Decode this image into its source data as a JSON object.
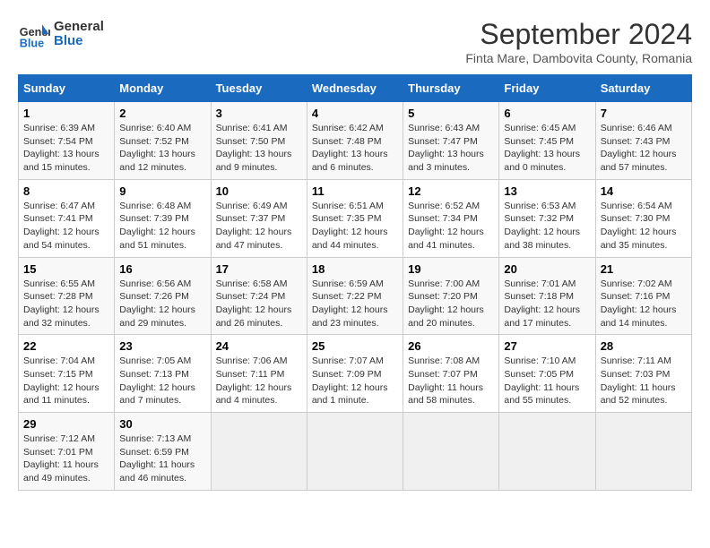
{
  "header": {
    "logo_line1": "General",
    "logo_line2": "Blue",
    "month_year": "September 2024",
    "location": "Finta Mare, Dambovita County, Romania"
  },
  "weekdays": [
    "Sunday",
    "Monday",
    "Tuesday",
    "Wednesday",
    "Thursday",
    "Friday",
    "Saturday"
  ],
  "weeks": [
    [
      {
        "day": "1",
        "sunrise": "6:39 AM",
        "sunset": "7:54 PM",
        "daylight": "13 hours and 15 minutes."
      },
      {
        "day": "2",
        "sunrise": "6:40 AM",
        "sunset": "7:52 PM",
        "daylight": "13 hours and 12 minutes."
      },
      {
        "day": "3",
        "sunrise": "6:41 AM",
        "sunset": "7:50 PM",
        "daylight": "13 hours and 9 minutes."
      },
      {
        "day": "4",
        "sunrise": "6:42 AM",
        "sunset": "7:48 PM",
        "daylight": "13 hours and 6 minutes."
      },
      {
        "day": "5",
        "sunrise": "6:43 AM",
        "sunset": "7:47 PM",
        "daylight": "13 hours and 3 minutes."
      },
      {
        "day": "6",
        "sunrise": "6:45 AM",
        "sunset": "7:45 PM",
        "daylight": "13 hours and 0 minutes."
      },
      {
        "day": "7",
        "sunrise": "6:46 AM",
        "sunset": "7:43 PM",
        "daylight": "12 hours and 57 minutes."
      }
    ],
    [
      {
        "day": "8",
        "sunrise": "6:47 AM",
        "sunset": "7:41 PM",
        "daylight": "12 hours and 54 minutes."
      },
      {
        "day": "9",
        "sunrise": "6:48 AM",
        "sunset": "7:39 PM",
        "daylight": "12 hours and 51 minutes."
      },
      {
        "day": "10",
        "sunrise": "6:49 AM",
        "sunset": "7:37 PM",
        "daylight": "12 hours and 47 minutes."
      },
      {
        "day": "11",
        "sunrise": "6:51 AM",
        "sunset": "7:35 PM",
        "daylight": "12 hours and 44 minutes."
      },
      {
        "day": "12",
        "sunrise": "6:52 AM",
        "sunset": "7:34 PM",
        "daylight": "12 hours and 41 minutes."
      },
      {
        "day": "13",
        "sunrise": "6:53 AM",
        "sunset": "7:32 PM",
        "daylight": "12 hours and 38 minutes."
      },
      {
        "day": "14",
        "sunrise": "6:54 AM",
        "sunset": "7:30 PM",
        "daylight": "12 hours and 35 minutes."
      }
    ],
    [
      {
        "day": "15",
        "sunrise": "6:55 AM",
        "sunset": "7:28 PM",
        "daylight": "12 hours and 32 minutes."
      },
      {
        "day": "16",
        "sunrise": "6:56 AM",
        "sunset": "7:26 PM",
        "daylight": "12 hours and 29 minutes."
      },
      {
        "day": "17",
        "sunrise": "6:58 AM",
        "sunset": "7:24 PM",
        "daylight": "12 hours and 26 minutes."
      },
      {
        "day": "18",
        "sunrise": "6:59 AM",
        "sunset": "7:22 PM",
        "daylight": "12 hours and 23 minutes."
      },
      {
        "day": "19",
        "sunrise": "7:00 AM",
        "sunset": "7:20 PM",
        "daylight": "12 hours and 20 minutes."
      },
      {
        "day": "20",
        "sunrise": "7:01 AM",
        "sunset": "7:18 PM",
        "daylight": "12 hours and 17 minutes."
      },
      {
        "day": "21",
        "sunrise": "7:02 AM",
        "sunset": "7:16 PM",
        "daylight": "12 hours and 14 minutes."
      }
    ],
    [
      {
        "day": "22",
        "sunrise": "7:04 AM",
        "sunset": "7:15 PM",
        "daylight": "12 hours and 11 minutes."
      },
      {
        "day": "23",
        "sunrise": "7:05 AM",
        "sunset": "7:13 PM",
        "daylight": "12 hours and 7 minutes."
      },
      {
        "day": "24",
        "sunrise": "7:06 AM",
        "sunset": "7:11 PM",
        "daylight": "12 hours and 4 minutes."
      },
      {
        "day": "25",
        "sunrise": "7:07 AM",
        "sunset": "7:09 PM",
        "daylight": "12 hours and 1 minute."
      },
      {
        "day": "26",
        "sunrise": "7:08 AM",
        "sunset": "7:07 PM",
        "daylight": "11 hours and 58 minutes."
      },
      {
        "day": "27",
        "sunrise": "7:10 AM",
        "sunset": "7:05 PM",
        "daylight": "11 hours and 55 minutes."
      },
      {
        "day": "28",
        "sunrise": "7:11 AM",
        "sunset": "7:03 PM",
        "daylight": "11 hours and 52 minutes."
      }
    ],
    [
      {
        "day": "29",
        "sunrise": "7:12 AM",
        "sunset": "7:01 PM",
        "daylight": "11 hours and 49 minutes."
      },
      {
        "day": "30",
        "sunrise": "7:13 AM",
        "sunset": "6:59 PM",
        "daylight": "11 hours and 46 minutes."
      },
      null,
      null,
      null,
      null,
      null
    ]
  ]
}
